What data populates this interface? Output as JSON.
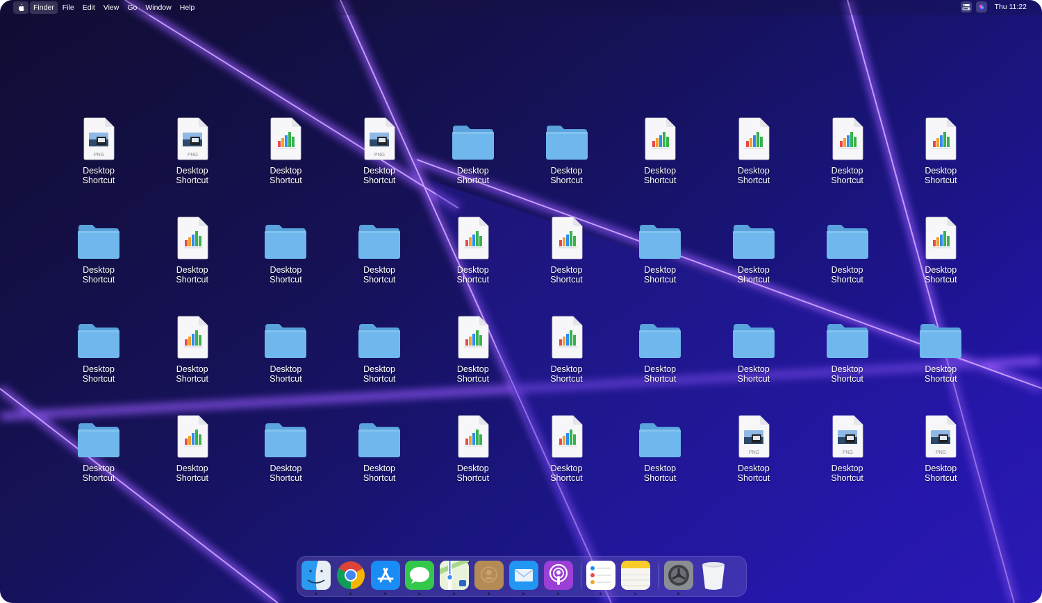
{
  "menubar": {
    "apple_icon": "apple-logo-icon",
    "items": [
      "Finder",
      "File",
      "Edit",
      "View",
      "Go",
      "Window",
      "Help"
    ],
    "active_item": "Finder",
    "status_icons": [
      "control-center-icon",
      "siri-icon"
    ],
    "clock": "Thu 11:22"
  },
  "desktop": {
    "rows": [
      [
        {
          "type": "png",
          "label_line1": "Desktop",
          "label_line2": "Shortcut"
        },
        {
          "type": "png",
          "label_line1": "Desktop",
          "label_line2": "Shortcut"
        },
        {
          "type": "chart",
          "label_line1": "Desktop",
          "label_line2": "Shortcut"
        },
        {
          "type": "png",
          "label_line1": "Desktop",
          "label_line2": "Shortcut"
        },
        {
          "type": "folder",
          "label_line1": "Desktop",
          "label_line2": "Shortcut"
        },
        {
          "type": "folder",
          "label_line1": "Desktop",
          "label_line2": "Shortcut"
        },
        {
          "type": "chart",
          "label_line1": "Desktop",
          "label_line2": "Shortcut"
        },
        {
          "type": "chart",
          "label_line1": "Desktop",
          "label_line2": "Shortcut"
        },
        {
          "type": "chart",
          "label_line1": "Desktop",
          "label_line2": "Shortcut"
        },
        {
          "type": "chart",
          "label_line1": "Desktop",
          "label_line2": "Shortcut"
        }
      ],
      [
        {
          "type": "folder",
          "label_line1": "Desktop",
          "label_line2": "Shortcut"
        },
        {
          "type": "chart",
          "label_line1": "Desktop",
          "label_line2": "Shortcut"
        },
        {
          "type": "folder",
          "label_line1": "Desktop",
          "label_line2": "Shortcut"
        },
        {
          "type": "folder",
          "label_line1": "Desktop",
          "label_line2": "Shortcut"
        },
        {
          "type": "chart",
          "label_line1": "Desktop",
          "label_line2": "Shortcut"
        },
        {
          "type": "chart",
          "label_line1": "Desktop",
          "label_line2": "Shortcut"
        },
        {
          "type": "folder",
          "label_line1": "Desktop",
          "label_line2": "Shortcut"
        },
        {
          "type": "folder",
          "label_line1": "Desktop",
          "label_line2": "Shortcut"
        },
        {
          "type": "folder",
          "label_line1": "Desktop",
          "label_line2": "Shortcut"
        },
        {
          "type": "chart",
          "label_line1": "Desktop",
          "label_line2": "Shortcut"
        }
      ],
      [
        {
          "type": "folder",
          "label_line1": "Desktop",
          "label_line2": "Shortcut"
        },
        {
          "type": "chart",
          "label_line1": "Desktop",
          "label_line2": "Shortcut"
        },
        {
          "type": "folder",
          "label_line1": "Desktop",
          "label_line2": "Shortcut"
        },
        {
          "type": "folder",
          "label_line1": "Desktop",
          "label_line2": "Shortcut"
        },
        {
          "type": "chart",
          "label_line1": "Desktop",
          "label_line2": "Shortcut"
        },
        {
          "type": "chart",
          "label_line1": "Desktop",
          "label_line2": "Shortcut"
        },
        {
          "type": "folder",
          "label_line1": "Desktop",
          "label_line2": "Shortcut"
        },
        {
          "type": "folder",
          "label_line1": "Desktop",
          "label_line2": "Shortcut"
        },
        {
          "type": "folder",
          "label_line1": "Desktop",
          "label_line2": "Shortcut"
        },
        {
          "type": "folder",
          "label_line1": "Desktop",
          "label_line2": "Shortcut"
        }
      ],
      [
        {
          "type": "folder",
          "label_line1": "Desktop",
          "label_line2": "Shortcut"
        },
        {
          "type": "chart",
          "label_line1": "Desktop",
          "label_line2": "Shortcut"
        },
        {
          "type": "folder",
          "label_line1": "Desktop",
          "label_line2": "Shortcut"
        },
        {
          "type": "folder",
          "label_line1": "Desktop",
          "label_line2": "Shortcut"
        },
        {
          "type": "chart",
          "label_line1": "Desktop",
          "label_line2": "Shortcut"
        },
        {
          "type": "chart",
          "label_line1": "Desktop",
          "label_line2": "Shortcut"
        },
        {
          "type": "folder",
          "label_line1": "Desktop",
          "label_line2": "Shortcut"
        },
        {
          "type": "png",
          "label_line1": "Desktop",
          "label_line2": "Shortcut"
        },
        {
          "type": "png",
          "label_line1": "Desktop",
          "label_line2": "Shortcut"
        },
        {
          "type": "png",
          "label_line1": "Desktop",
          "label_line2": "Shortcut"
        }
      ]
    ],
    "png_badge": "PNG"
  },
  "dock": {
    "groups": [
      [
        {
          "name": "finder",
          "icon": "finder-icon",
          "running": true
        },
        {
          "name": "chrome",
          "icon": "chrome-icon",
          "running": true
        },
        {
          "name": "app-store",
          "icon": "app-store-icon",
          "running": true
        },
        {
          "name": "messages",
          "icon": "messages-icon",
          "running": true
        },
        {
          "name": "maps",
          "icon": "maps-icon",
          "running": true
        },
        {
          "name": "contacts",
          "icon": "contacts-icon",
          "running": true
        },
        {
          "name": "mail",
          "icon": "mail-icon",
          "running": true
        },
        {
          "name": "podcasts",
          "icon": "podcasts-icon",
          "running": true
        }
      ],
      [
        {
          "name": "reminders",
          "icon": "reminders-icon",
          "running": true
        },
        {
          "name": "notes",
          "icon": "notes-icon",
          "running": true
        }
      ],
      [
        {
          "name": "system-preferences",
          "icon": "system-preferences-icon",
          "running": true
        },
        {
          "name": "trash",
          "icon": "trash-icon",
          "running": false
        }
      ]
    ]
  },
  "colors": {
    "folder": "#6fb7ec",
    "folder_tab": "#5aa3dc",
    "wallpaper_beam": "#a46cff"
  }
}
